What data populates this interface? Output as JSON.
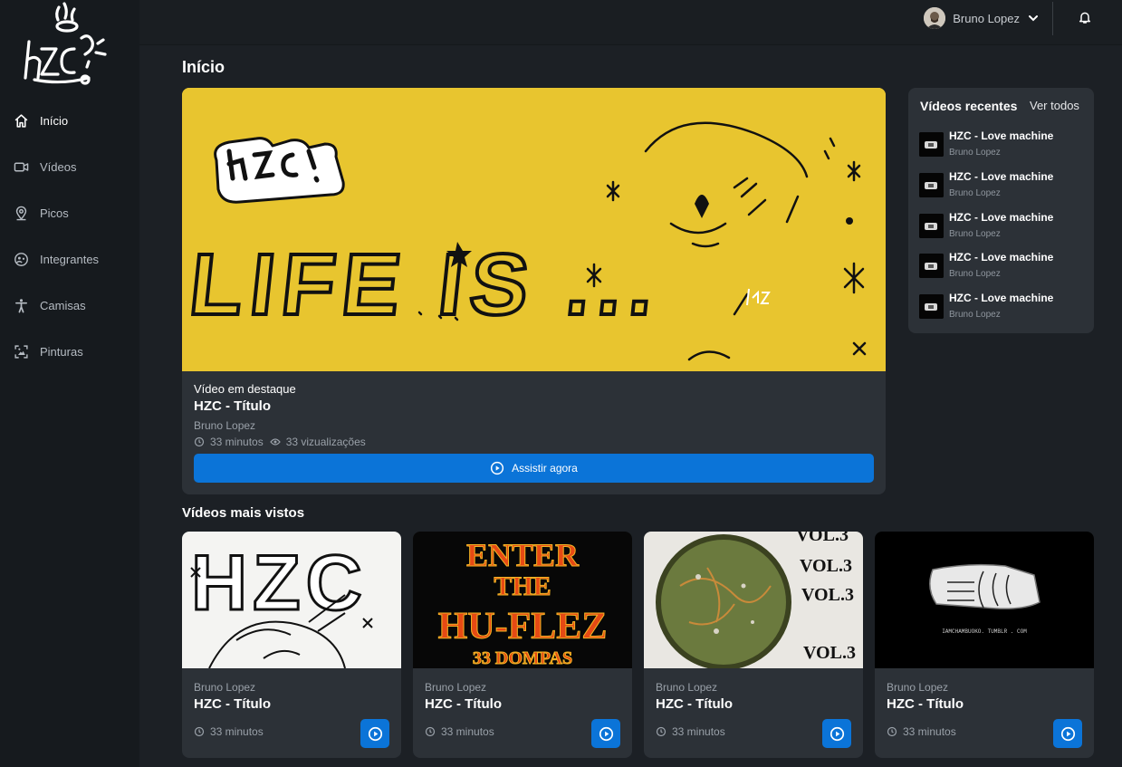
{
  "brand": {
    "logo_text": "hzc"
  },
  "sidebar": {
    "items": [
      {
        "label": "Início",
        "icon": "home-icon",
        "active": true
      },
      {
        "label": "Vídeos",
        "icon": "video-icon",
        "active": false
      },
      {
        "label": "Picos",
        "icon": "map-pin-icon",
        "active": false
      },
      {
        "label": "Integrantes",
        "icon": "users-icon",
        "active": false
      },
      {
        "label": "Camisas",
        "icon": "person-icon",
        "active": false
      },
      {
        "label": "Pinturas",
        "icon": "image-icon",
        "active": false
      }
    ]
  },
  "topbar": {
    "user_name": "Bruno Lopez"
  },
  "page": {
    "title": "Início"
  },
  "featured": {
    "label": "Vídeo em destaque",
    "title": "HZC - Título",
    "author": "Bruno Lopez",
    "duration": "33 minutos",
    "views": "33 vizualizações",
    "button_label": "Assistir agora",
    "artwork_text": "LIFE IS ..."
  },
  "recent": {
    "title": "Vídeos recentes",
    "see_all": "Ver todos",
    "items": [
      {
        "title": "HZC - Love machine",
        "author": "Bruno Lopez"
      },
      {
        "title": "HZC - Love machine",
        "author": "Bruno Lopez"
      },
      {
        "title": "HZC - Love machine",
        "author": "Bruno Lopez"
      },
      {
        "title": "HZC - Love machine",
        "author": "Bruno Lopez"
      },
      {
        "title": "HZC - Love machine",
        "author": "Bruno Lopez"
      }
    ]
  },
  "most_viewed": {
    "title": "Vídeos mais vistos",
    "cards": [
      {
        "author": "Bruno Lopez",
        "title": "HZC - Título",
        "duration": "33 minutos",
        "thumb_text": "HZC"
      },
      {
        "author": "Bruno Lopez",
        "title": "HZC - Título",
        "duration": "33 minutos",
        "thumb_lines": [
          "ENTER",
          "THE",
          "HU-FLEZ",
          "33 DOMPAS"
        ]
      },
      {
        "author": "Bruno Lopez",
        "title": "HZC - Título",
        "duration": "33 minutos",
        "thumb_lines": [
          "VOL.3",
          "VOL.3",
          "VOL.3",
          "VOL.3"
        ]
      },
      {
        "author": "Bruno Lopez",
        "title": "HZC - Título",
        "duration": "33 minutos",
        "thumb_text": "IAMCHAMBUOKO. TUMBLR . COM"
      }
    ]
  },
  "colors": {
    "accent": "#0b74d8",
    "featured_bg": "#e8c52f",
    "panel": "#2c3137",
    "sidebar": "#161a1e"
  }
}
